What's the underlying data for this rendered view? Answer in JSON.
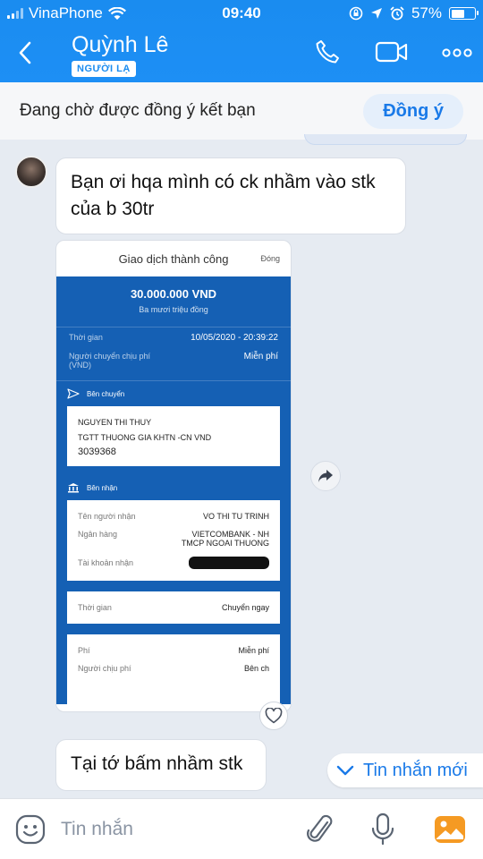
{
  "status_bar": {
    "carrier": "VinaPhone",
    "time": "09:40",
    "battery_percent": "57%",
    "battery_level": 0.57,
    "icons": [
      "signal-icon",
      "wifi-icon",
      "screen-lock-icon",
      "location-icon",
      "alarm-icon",
      "battery-icon"
    ]
  },
  "header": {
    "contact_name": "Quỳnh Lê",
    "badge": "NGƯỜI LẠ",
    "icons": [
      "back-icon",
      "phone-icon",
      "video-call-icon",
      "more-icon"
    ]
  },
  "friend_request": {
    "text": "Đang chờ được đồng ý kết bạn",
    "accept_label": "Đồng ý"
  },
  "messages": [
    {
      "text": "Bạn ơi hqa mình có ck nhầm vào stk của b 30tr"
    },
    {
      "text": "Tại tớ bấm nhầm stk"
    }
  ],
  "transaction_image": {
    "title": "Giao dịch thành công",
    "close_label": "Đóng",
    "amount": "30.000.000 VND",
    "amount_words": "Ba mươi triệu đồng",
    "time_label": "Thời gian",
    "time_value": "10/05/2020 - 20:39:22",
    "fee_payer_label": "Người chuyển chịu phí (VND)",
    "fee_payer_value": "Miễn phí",
    "sender_section": "Bên chuyển",
    "sender_name": "NGUYEN THI THUY",
    "sender_account_name": "TGTT THUONG GIA KHTN -CN VND",
    "sender_account_number": "3039368",
    "receiver_section": "Bên nhận",
    "receiver_name_label": "Tên người nhận",
    "receiver_name_value": "VO THI TU TRINH",
    "bank_label": "Ngân hàng",
    "bank_value": "VIETCOMBANK - NH TMCP NGOAI THUONG",
    "account_label": "Tài khoản nhận",
    "time2_label": "Thời gian",
    "time2_value": "Chuyển ngay",
    "fee_label": "Phí",
    "fee_value": "Miễn phí",
    "payer_label": "Người chịu phí",
    "payer_value": "Bên ch"
  },
  "new_messages": {
    "label": "Tin nhắn mới"
  },
  "composer": {
    "placeholder": "Tin nhắn",
    "icons": [
      "emoji-icon",
      "attachment-icon",
      "microphone-icon",
      "image-icon"
    ]
  },
  "colors": {
    "header": "#1a8cf0",
    "bank_blue": "#1560b4",
    "accent": "#1a7ae8"
  }
}
